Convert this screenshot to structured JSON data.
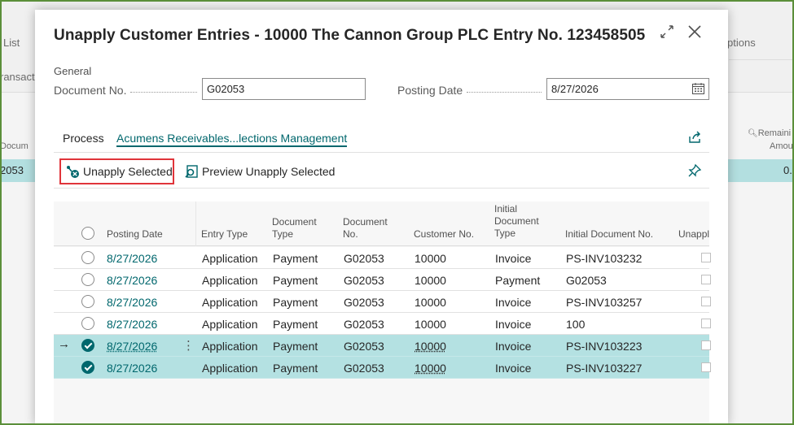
{
  "background": {
    "list_label": "List",
    "options_label": "ptions",
    "transact_label": "ransact",
    "docum_label": "Docum",
    "row_value": "2053",
    "remaining_header_1": "Remaini",
    "remaining_header_2": "Amou",
    "remaining_value": "0."
  },
  "dialog": {
    "title": "Unapply Customer Entries - 10000 The Cannon Group PLC Entry No. 123458505",
    "expand_icon": "expand-icon",
    "close_icon": "close-icon"
  },
  "general": {
    "section_label": "General",
    "document_no_label": "Document No.",
    "document_no_value": "G02053",
    "posting_date_label": "Posting Date",
    "posting_date_value": "8/27/2026"
  },
  "actions": {
    "tab_process": "Process",
    "tab_acumens": "Acumens Receivables...lections Management",
    "unapply_selected": "Unapply Selected",
    "preview_unapply_selected": "Preview Unapply Selected"
  },
  "table": {
    "headers": {
      "posting_date": "Posting Date",
      "entry_type": "Entry Type",
      "document_type_1": "Document",
      "document_type_2": "Type",
      "document_no_1": "Document",
      "document_no_2": "No.",
      "customer_no": "Customer No.",
      "initial_doc_type_1": "Initial",
      "initial_doc_type_2": "Document",
      "initial_doc_type_3": "Type",
      "initial_doc_no": "Initial Document No.",
      "unapply": "Unappl"
    },
    "rows": [
      {
        "posting_date": "8/27/2026",
        "entry_type": "Application",
        "document_type": "Payment",
        "document_no": "G02053",
        "customer_no": "10000",
        "initial_doc_type": "Invoice",
        "initial_doc_no": "PS-INV103232"
      },
      {
        "posting_date": "8/27/2026",
        "entry_type": "Application",
        "document_type": "Payment",
        "document_no": "G02053",
        "customer_no": "10000",
        "initial_doc_type": "Payment",
        "initial_doc_no": "G02053"
      },
      {
        "posting_date": "8/27/2026",
        "entry_type": "Application",
        "document_type": "Payment",
        "document_no": "G02053",
        "customer_no": "10000",
        "initial_doc_type": "Invoice",
        "initial_doc_no": "PS-INV103257"
      },
      {
        "posting_date": "8/27/2026",
        "entry_type": "Application",
        "document_type": "Payment",
        "document_no": "G02053",
        "customer_no": "10000",
        "initial_doc_type": "Invoice",
        "initial_doc_no": "100"
      },
      {
        "posting_date": "8/27/2026",
        "entry_type": "Application",
        "document_type": "Payment",
        "document_no": "G02053",
        "customer_no": "10000",
        "initial_doc_type": "Invoice",
        "initial_doc_no": "PS-INV103223"
      },
      {
        "posting_date": "8/27/2026",
        "entry_type": "Application",
        "document_type": "Payment",
        "document_no": "G02053",
        "customer_no": "10000",
        "initial_doc_type": "Invoice",
        "initial_doc_no": "PS-INV103227"
      }
    ]
  },
  "colors": {
    "accent": "#00676d",
    "selected_row": "#b4e1e2",
    "highlight_border": "#e0343a",
    "frame_border": "#5b8f3a"
  }
}
